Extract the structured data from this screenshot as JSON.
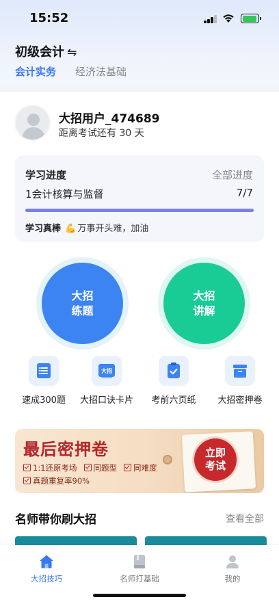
{
  "status_bar": {
    "time": "15:52"
  },
  "header": {
    "subject": "初级会计",
    "tabs": [
      {
        "label": "会计实务",
        "active": true
      },
      {
        "label": "经济法基础",
        "active": false
      }
    ]
  },
  "user": {
    "name": "大招用户_474689",
    "countdown": "距离考试还有 30 天"
  },
  "progress": {
    "title": "学习进度",
    "all_link": "全部进度",
    "chapter": "1会计核算与监督",
    "count": "7/7",
    "fraction": 1.0,
    "slogan_bold": "学习真棒",
    "slogan_text": "万事开头难，加油"
  },
  "main_buttons": [
    {
      "line1": "大招",
      "line2": "练题",
      "color": "#3b84f1"
    },
    {
      "line1": "大招",
      "line2": "讲解",
      "color": "#19cc96"
    }
  ],
  "quick_items": [
    {
      "label": "速成300题",
      "icon": "list-book-icon"
    },
    {
      "label": "大招口诀卡片",
      "icon_text": "大招",
      "icon": "card-icon"
    },
    {
      "label": "考前六页纸",
      "icon": "clipboard-check-icon"
    },
    {
      "label": "大招密押卷",
      "icon": "archive-box-icon"
    }
  ],
  "banner": {
    "title": "最后密押卷",
    "tags": [
      "1:1还原考场",
      "同题型",
      "同难度",
      "真题重复率90%"
    ],
    "button_line1": "立即",
    "button_line2": "考试"
  },
  "teachers_section": {
    "title": "名师带你刷大招",
    "more": "查看全部"
  },
  "tab_bar": [
    {
      "label": "大招技巧",
      "active": true,
      "icon": "home-icon"
    },
    {
      "label": "名师打基础",
      "active": false,
      "icon": "book-icon"
    },
    {
      "label": "我的",
      "active": false,
      "icon": "person-icon"
    }
  ],
  "colors": {
    "accent": "#3a78ee",
    "blue_button": "#3b84f1",
    "green_button": "#19cc96",
    "banner_red": "#b5262b"
  }
}
